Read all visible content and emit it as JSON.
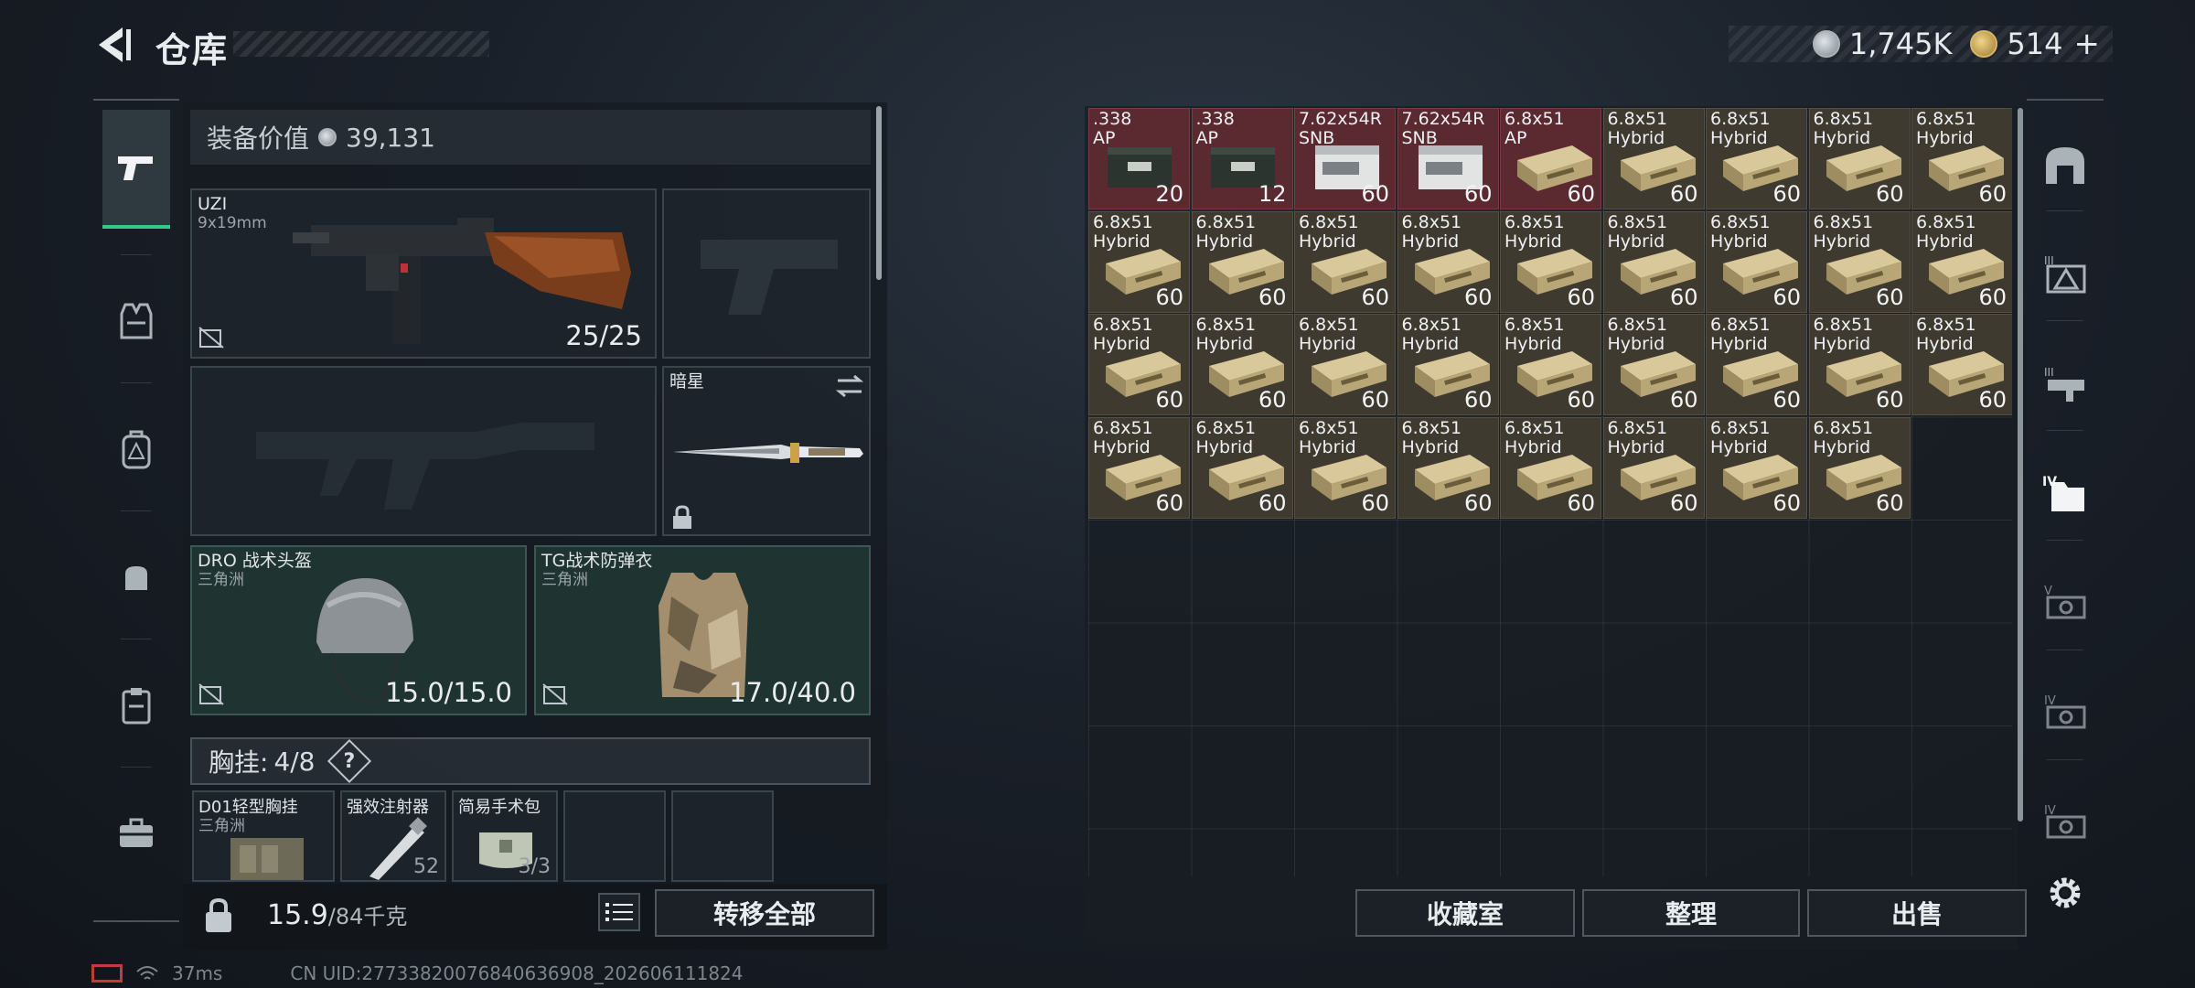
{
  "header": {
    "title": "仓库",
    "currency": [
      {
        "icon": "silver-coin-icon",
        "value": "1,745K"
      },
      {
        "icon": "gold-coin-icon",
        "value": "514"
      }
    ],
    "add_label": "+"
  },
  "left_rail": {
    "items": [
      "pistol-icon",
      "vest-icon",
      "backpack-icon",
      "bag-icon",
      "clipboard-icon",
      "toolbox-icon"
    ],
    "active": 0
  },
  "loadout": {
    "value_label": "装备价值",
    "value": "39,131",
    "primary": {
      "name": "UZI",
      "caliber": "9x19mm",
      "ammo": "25/25"
    },
    "melee": {
      "name": "暗星"
    },
    "helmet": {
      "name": "DRO 战术头盔",
      "faction": "三角洲",
      "durability": "15.0/15.0"
    },
    "armor": {
      "name": "TG战术防弹衣",
      "faction": "三角洲",
      "durability": "17.0/40.0"
    },
    "chest_label": "胸挂:",
    "chest_count": "4/8",
    "chest_help": "?",
    "chest_items": [
      {
        "name": "D01轻型胸挂",
        "sub": "三角洲"
      },
      {
        "name": "强效注射器",
        "sub": "52"
      },
      {
        "name": "简易手术包",
        "sub": "3/3"
      }
    ],
    "weight": "15.9",
    "weight_max": "/84千克",
    "transfer_all": "转移全部"
  },
  "stash": {
    "items": [
      {
        "l1": ".338",
        "l2": "AP",
        "qty": "20",
        "kind": "red"
      },
      {
        "l1": ".338",
        "l2": "AP",
        "qty": "12",
        "kind": "red"
      },
      {
        "l1": "7.62x54R",
        "l2": "SNB",
        "qty": "60",
        "kind": "red"
      },
      {
        "l1": "7.62x54R",
        "l2": "SNB",
        "qty": "60",
        "kind": "red"
      },
      {
        "l1": "6.8x51",
        "l2": "AP",
        "qty": "60",
        "kind": "red"
      },
      {
        "l1": "6.8x51",
        "l2": "Hybrid",
        "qty": "60",
        "kind": "tan"
      },
      {
        "l1": "6.8x51",
        "l2": "Hybrid",
        "qty": "60",
        "kind": "tan"
      },
      {
        "l1": "6.8x51",
        "l2": "Hybrid",
        "qty": "60",
        "kind": "tan"
      },
      {
        "l1": "6.8x51",
        "l2": "Hybrid",
        "qty": "60",
        "kind": "tan"
      },
      {
        "l1": "6.8x51",
        "l2": "Hybrid",
        "qty": "60",
        "kind": "tan"
      },
      {
        "l1": "6.8x51",
        "l2": "Hybrid",
        "qty": "60",
        "kind": "tan"
      },
      {
        "l1": "6.8x51",
        "l2": "Hybrid",
        "qty": "60",
        "kind": "tan"
      },
      {
        "l1": "6.8x51",
        "l2": "Hybrid",
        "qty": "60",
        "kind": "tan"
      },
      {
        "l1": "6.8x51",
        "l2": "Hybrid",
        "qty": "60",
        "kind": "tan"
      },
      {
        "l1": "6.8x51",
        "l2": "Hybrid",
        "qty": "60",
        "kind": "tan"
      },
      {
        "l1": "6.8x51",
        "l2": "Hybrid",
        "qty": "60",
        "kind": "tan"
      },
      {
        "l1": "6.8x51",
        "l2": "Hybrid",
        "qty": "60",
        "kind": "tan"
      },
      {
        "l1": "6.8x51",
        "l2": "Hybrid",
        "qty": "60",
        "kind": "tan"
      },
      {
        "l1": "6.8x51",
        "l2": "Hybrid",
        "qty": "60",
        "kind": "tan"
      },
      {
        "l1": "6.8x51",
        "l2": "Hybrid",
        "qty": "60",
        "kind": "tan"
      },
      {
        "l1": "6.8x51",
        "l2": "Hybrid",
        "qty": "60",
        "kind": "tan"
      },
      {
        "l1": "6.8x51",
        "l2": "Hybrid",
        "qty": "60",
        "kind": "tan"
      },
      {
        "l1": "6.8x51",
        "l2": "Hybrid",
        "qty": "60",
        "kind": "tan"
      },
      {
        "l1": "6.8x51",
        "l2": "Hybrid",
        "qty": "60",
        "kind": "tan"
      },
      {
        "l1": "6.8x51",
        "l2": "Hybrid",
        "qty": "60",
        "kind": "tan"
      },
      {
        "l1": "6.8x51",
        "l2": "Hybrid",
        "qty": "60",
        "kind": "tan"
      },
      {
        "l1": "6.8x51",
        "l2": "Hybrid",
        "qty": "60",
        "kind": "tan"
      },
      {
        "l1": "6.8x51",
        "l2": "Hybrid",
        "qty": "60",
        "kind": "tan"
      },
      {
        "l1": "6.8x51",
        "l2": "Hybrid",
        "qty": "60",
        "kind": "tan"
      },
      {
        "l1": "6.8x51",
        "l2": "Hybrid",
        "qty": "60",
        "kind": "tan"
      },
      {
        "l1": "6.8x51",
        "l2": "Hybrid",
        "qty": "60",
        "kind": "tan"
      },
      {
        "l1": "6.8x51",
        "l2": "Hybrid",
        "qty": "60",
        "kind": "tan"
      },
      {
        "l1": "6.8x51",
        "l2": "Hybrid",
        "qty": "60",
        "kind": "tan"
      },
      {
        "l1": "6.8x51",
        "l2": "Hybrid",
        "qty": "60",
        "kind": "tan"
      },
      {
        "l1": "6.8x51",
        "l2": "Hybrid",
        "qty": "60",
        "kind": "tan"
      }
    ],
    "buttons": {
      "collection": "收藏室",
      "sort": "整理",
      "sell": "出售"
    }
  },
  "right_rail": {
    "items": [
      "stash-arch-icon",
      "stash-tier-2-icon",
      "stash-tier-3-icon",
      "stash-tier-4-active-icon",
      "stash-tier-5-icon",
      "stash-tier-4b-icon",
      "stash-tier-4c-icon",
      "settings-icon"
    ]
  },
  "footer": {
    "ping": "37ms",
    "uid": "CN UID:27733820076840636908_202606111824"
  },
  "colors": {
    "accent": "#34c88a",
    "ammo_tan": "#3e3a2f",
    "ammo_red": "#5a2a30"
  }
}
